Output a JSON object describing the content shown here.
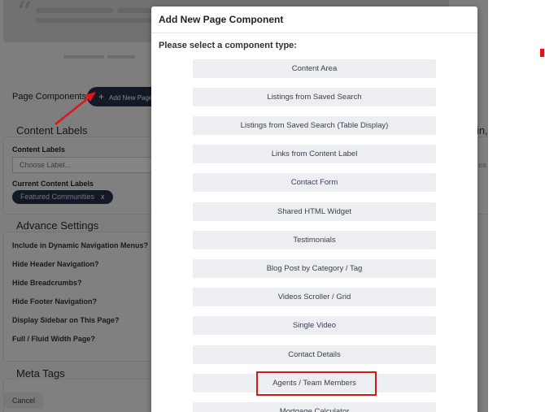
{
  "background": {
    "page_components_label": "Page Components",
    "add_new_button": "Add New Page",
    "add_new_plus": "+",
    "content_labels_section": "Content Labels",
    "content_labels_field": "Content Labels",
    "choose_label_placeholder": "Choose Label...",
    "current_content_labels_field": "Current Content Labels",
    "current_tag": "Featured Communities",
    "current_tag_remove": "x",
    "advance_settings_section": "Advance Settings",
    "advance_items": [
      "Include in Dynamic Navigation Menus?",
      "Hide Header Navigation?",
      "Hide Breadcrumbs?",
      "Hide Footer Navigation?",
      "Display Sidebar on This Page?",
      "Full / Fluid Width Page?"
    ],
    "meta_tags_section": "Meta Tags",
    "cancel_button": "Cancel",
    "right_fragment_title": "in,",
    "right_fragment_text": "ea"
  },
  "modal": {
    "title": "Add New Page Component",
    "prompt": "Please select a component type:",
    "components": [
      "Content Area",
      "Listings from Saved Search",
      "Listings from Saved Search (Table Display)",
      "Links from Content Label",
      "Contact Form",
      "Shared HTML Widget",
      "Testimonials",
      "Blog Post by Category / Tag",
      "Videos Scroller / Grid",
      "Single Video",
      "Contact Details",
      "Agents / Team Members",
      "Mortgage Calculator"
    ],
    "highlighted_component": "Agents / Team Members"
  },
  "colors": {
    "accent_dark": "#26324a",
    "highlight_red": "#d11a1a",
    "button_bg": "#eceef1"
  },
  "icons": [
    "quote-icon",
    "plus-icon",
    "arrow-annotation"
  ]
}
